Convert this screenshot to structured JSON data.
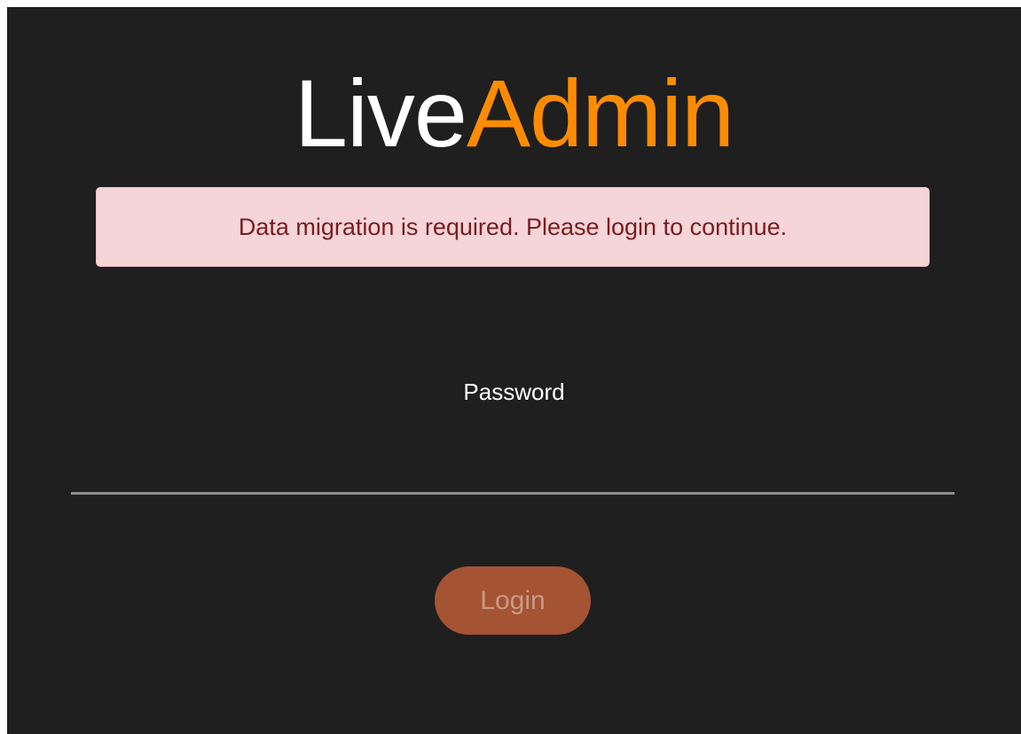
{
  "logo": {
    "part1": "Live",
    "part2": "Admin",
    "color_part1": "#ffffff",
    "color_part2": "#ff8c00"
  },
  "alert": {
    "message": "Data migration is required. Please login to continue.",
    "background": "#f5d5d7",
    "text_color": "#7a1c22"
  },
  "login_form": {
    "password_label": "Password",
    "password_value": "",
    "login_button_label": "Login",
    "button_color": "#a45333"
  },
  "theme": {
    "background": "#1f1f1f"
  }
}
